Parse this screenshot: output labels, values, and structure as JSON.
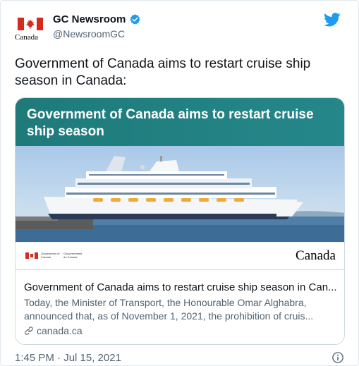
{
  "account": {
    "display_name": "GC Newsroom",
    "handle": "@NewsroomGC",
    "avatar_wordmark": "Canada",
    "verified_icon": "verified-badge-icon",
    "brand_icon": "twitter-bird-icon"
  },
  "tweet": {
    "text": "Government of Canada aims to restart cruise ship season in Canada:",
    "timestamp": "1:45 PM · Jul 15, 2021"
  },
  "card": {
    "banner_text": "Government of Canada aims to restart cruise ship season",
    "signature_en": "Government of Canada",
    "signature_fr": "Gouvernement du Canada",
    "wordmark": "Canada",
    "title": "Government of Canada aims to restart cruise ship season in Can...",
    "description_line1": "Today, the Minister of Transport, the Honourable Omar Alghabra,",
    "description_line2": "announced that, as of November 1, 2021, the prohibition of cruis...",
    "domain": "canada.ca"
  },
  "colors": {
    "canada_red": "#d52b1e",
    "banner_teal": "#1f7a7a",
    "verified_blue": "#1d9bf0",
    "twitter_blue": "#1d9bf0",
    "muted_text": "#536471"
  }
}
